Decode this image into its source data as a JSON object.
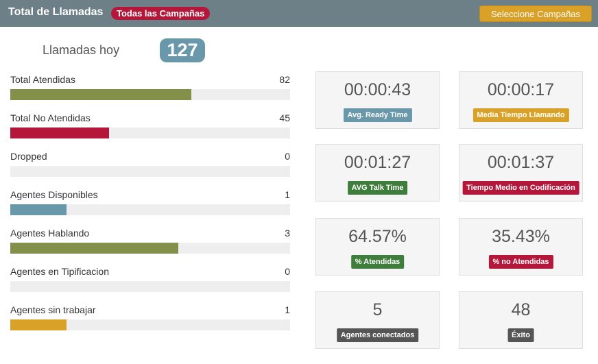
{
  "header": {
    "title": "Total de Llamadas",
    "badge": "Todas las Campañas",
    "select_button": "Seleccione Campañas"
  },
  "calls_today": {
    "label": "Llamadas hoy",
    "value": "127"
  },
  "stats": [
    {
      "label": "Total Atendidas",
      "value": "82",
      "fill_fraction": 0.646,
      "color": "#83904a"
    },
    {
      "label": "Total No Atendidas",
      "value": "45",
      "fill_fraction": 0.354,
      "color": "#b5173b"
    },
    {
      "label": "Dropped",
      "value": "0",
      "fill_fraction": 0,
      "color": "#83904a"
    },
    {
      "label": "Agentes Disponibles",
      "value": "1",
      "fill_fraction": 0.2,
      "color": "#6a98ab"
    },
    {
      "label": "Agentes Hablando",
      "value": "3",
      "fill_fraction": 0.6,
      "color": "#83904a"
    },
    {
      "label": "Agentes en Tipificacion",
      "value": "0",
      "fill_fraction": 0,
      "color": "#83904a"
    },
    {
      "label": "Agentes sin trabajar",
      "value": "1",
      "fill_fraction": 0.2,
      "color": "#d9a127"
    }
  ],
  "cards": [
    {
      "value": "00:00:43",
      "label": "Avg. Ready Time",
      "color": "#6a98ab"
    },
    {
      "value": "00:00:17",
      "label": "Media Tiempo Llamando",
      "color": "#d9a127"
    },
    {
      "value": "00:01:27",
      "label": "AVG Talk Time",
      "color": "#3f7d3c"
    },
    {
      "value": "00:01:37",
      "label": "Tiempo Medio en Codificación",
      "color": "#b5173b"
    },
    {
      "value": "64.57%",
      "label": "% Atendidas",
      "color": "#3f7d3c"
    },
    {
      "value": "35.43%",
      "label": "% no Atendidas",
      "color": "#b5173b"
    },
    {
      "value": "5",
      "label": "Agentes conectados",
      "color": "#555555"
    },
    {
      "value": "48",
      "label": "Éxito",
      "color": "#555555"
    }
  ]
}
